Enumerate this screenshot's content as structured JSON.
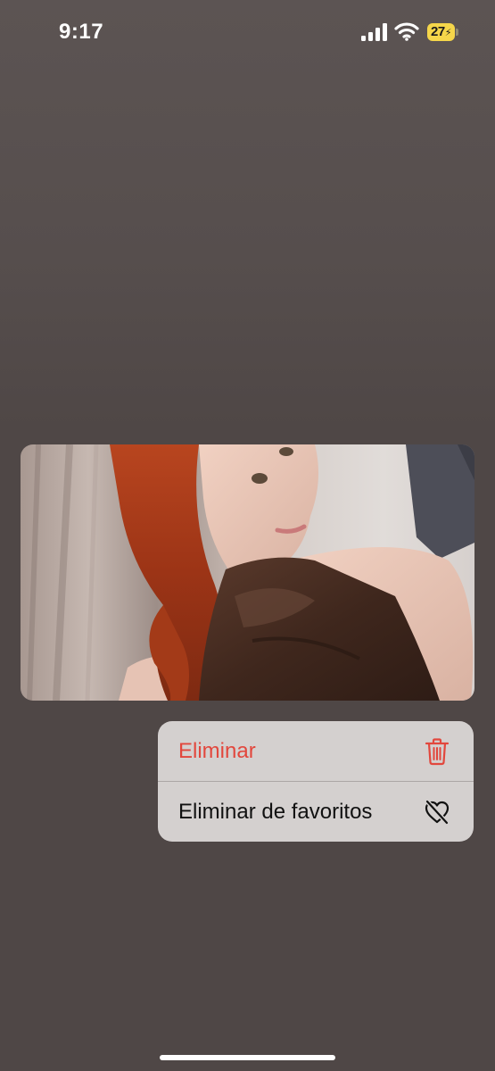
{
  "status_bar": {
    "time": "9:17",
    "battery_level": "27",
    "battery_charging": true,
    "battery_color": "#f5d64a",
    "icons": [
      "signal-icon",
      "wifi-icon",
      "battery-icon"
    ]
  },
  "photo": {
    "description_icon": "photo-preview"
  },
  "context_menu": {
    "items": [
      {
        "label": "Eliminar",
        "icon": "trash-icon",
        "color": "#e2473d"
      },
      {
        "label": "Eliminar de favoritos",
        "icon": "heart-slash-icon",
        "color": "#111111"
      }
    ]
  },
  "colors": {
    "background": "#4f4746",
    "menu_background": "#d4d0cf",
    "destructive": "#e2473d"
  }
}
